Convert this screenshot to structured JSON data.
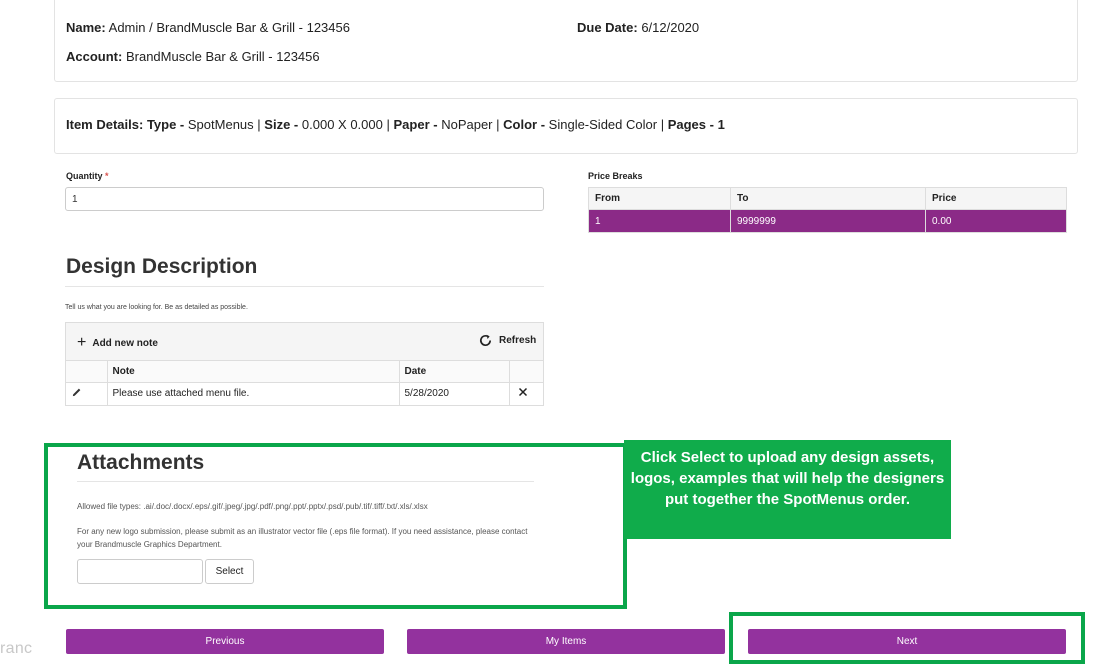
{
  "order_info": {
    "name_label": "Name:",
    "name_value": "Admin / BrandMuscle Bar & Grill - 123456",
    "due_label": "Due Date:",
    "due_value": "6/12/2020",
    "account_label": "Account:",
    "account_value": "BrandMuscle Bar & Grill - 123456"
  },
  "item_details": {
    "label": "Item Details:",
    "type_label": "Type -",
    "type_value": "SpotMenus",
    "size_label": "Size -",
    "size_value": "0.000 X 0.000",
    "paper_label": "Paper -",
    "paper_value": "NoPaper",
    "color_label": "Color -",
    "color_value": "Single-Sided Color",
    "pages_label": "Pages -",
    "pages_value": "1",
    "separator": "|"
  },
  "quantity": {
    "label": "Quantity",
    "required_mark": "*",
    "value": "1"
  },
  "price_breaks": {
    "title": "Price Breaks",
    "columns": [
      "From",
      "To",
      "Price"
    ],
    "rows": [
      [
        "1",
        "9999999",
        "0.00"
      ]
    ]
  },
  "design_description": {
    "heading": "Design Description",
    "hint": "Tell us what you are looking for. Be as detailed as possible.",
    "add_note_label": "Add new note",
    "refresh_label": "Refresh",
    "columns": [
      "Note",
      "Date"
    ],
    "notes": [
      {
        "note": "Please use attached menu file.",
        "date": "5/28/2020"
      }
    ]
  },
  "attachments": {
    "heading": "Attachments",
    "allowed_types": "Allowed file types: .ai/.doc/.docx/.eps/.gif/.jpeg/.jpg/.pdf/.png/.ppt/.pptx/.psd/.pub/.tif/.tiff/.txt/.xls/.xlsx",
    "logo_note": "For any new logo submission, please submit as an illustrator vector file (.eps file format). If you need assistance, please contact your Brandmuscle Graphics Department.",
    "select_label": "Select"
  },
  "callout": {
    "text": "Click Select to upload any design assets, logos, examples that will help the designers put together the SpotMenus order."
  },
  "nav": {
    "previous_label": "Previous",
    "my_items_label": "My Items",
    "next_label": "Next"
  },
  "brand": {
    "logo_text": "ranc"
  },
  "colors": {
    "accent_purple": "#93329e",
    "table_row_purple": "#8b2a87",
    "highlight_green": "#0aa64a"
  }
}
